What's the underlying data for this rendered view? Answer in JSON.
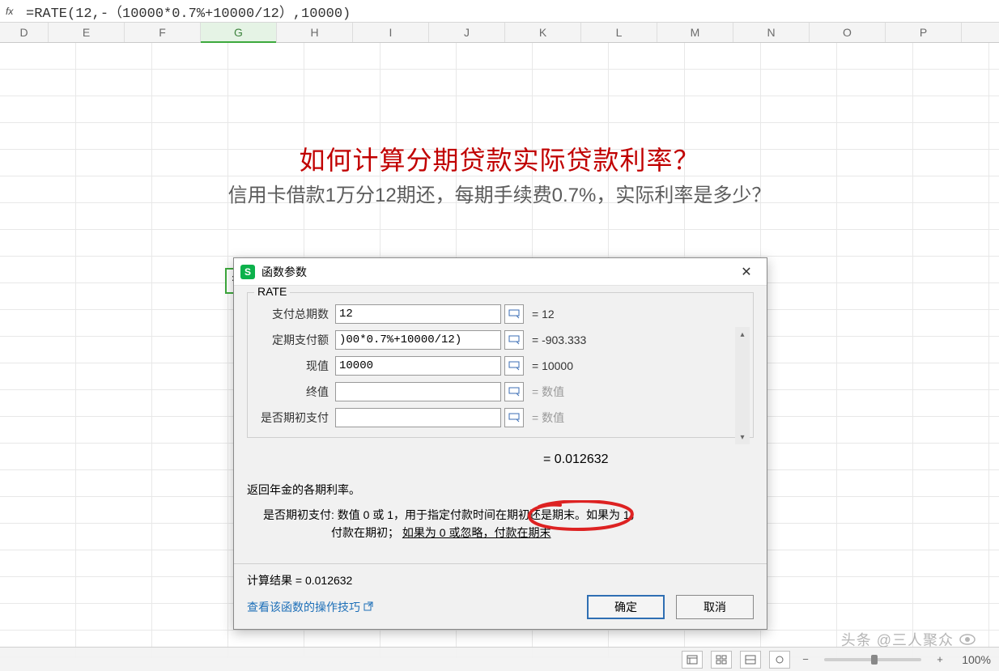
{
  "formula_bar": {
    "formula": "=RATE(12,-（10000*0.7%+10000/12）,10000)"
  },
  "columns": [
    "D",
    "E",
    "F",
    "G",
    "H",
    "I",
    "J",
    "K",
    "L",
    "M",
    "N",
    "O",
    "P"
  ],
  "selected_column": "G",
  "sheet": {
    "title_red": "如何计算分期贷款实际贷款利率？",
    "subtitle": "信用卡借款1万分12期还，每期手续费0.7%，实际利率是多少？",
    "editing_cell": "=RATE(12,-（10000*0.7%+10000/12）,10000)"
  },
  "dialog": {
    "title": "函数参数",
    "function_name": "RATE",
    "args": [
      {
        "label": "支付总期数",
        "value": "12",
        "result": "= 12"
      },
      {
        "label": "定期支付额",
        "value": ")00*0.7%+10000/12)",
        "result": "= -903.333"
      },
      {
        "label": "现值",
        "value": "10000",
        "result": "= 10000"
      },
      {
        "label": "终值",
        "value": "",
        "result": "= 数值"
      },
      {
        "label": "是否期初支付",
        "value": "",
        "result": "= 数值"
      }
    ],
    "fn_result": "= 0.012632",
    "desc1": "返回年金的各期利率。",
    "desc2a": "是否期初支付: 数值 0 或 1，用于指定付款时间在期初还是期末。如果为 1，",
    "desc2b": "付款在期初；",
    "desc2c": "如果为 0 或忽略，付款在期末",
    "calc_label": "计算结果 = 0.012632",
    "help_link": "查看该函数的操作技巧",
    "ok": "确定",
    "cancel": "取消"
  },
  "status": {
    "zoom_label": "100%"
  },
  "watermark": "头条 @三人聚众"
}
